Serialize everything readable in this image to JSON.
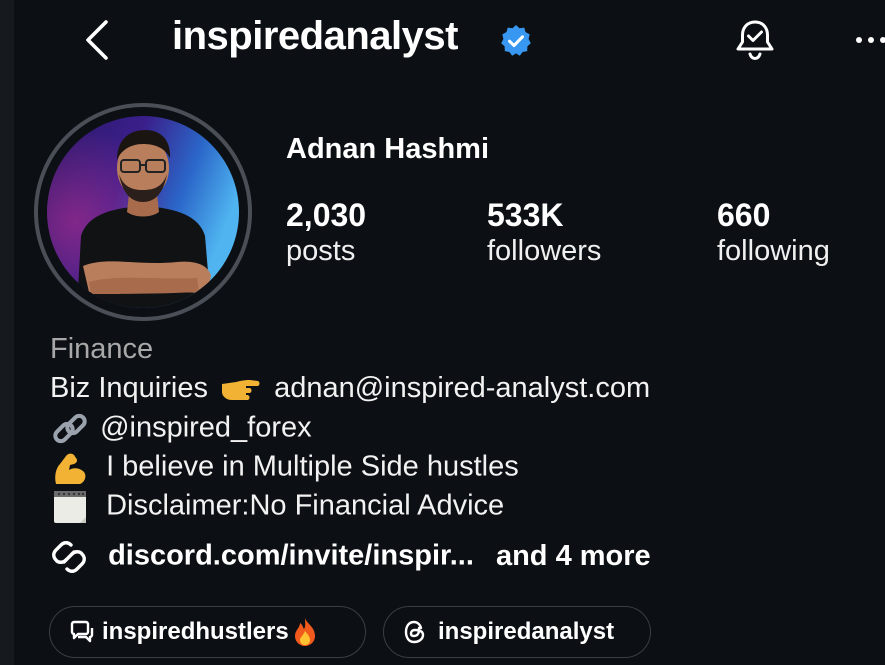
{
  "colors": {
    "background": "#0c1014",
    "verified": "#3897f0",
    "muted": "#a8a8a8",
    "accent": "#f5f5f5"
  },
  "header": {
    "username": "inspiredanalyst",
    "icons": [
      "chevron-left-icon",
      "verified-badge-icon",
      "bell-check-icon",
      "more-icon"
    ]
  },
  "profile": {
    "full_name": "Adnan Hashmi",
    "stats": [
      {
        "value": "2,030",
        "label": "posts"
      },
      {
        "value": "533K",
        "label": "followers"
      },
      {
        "value": "660",
        "label": "following"
      }
    ]
  },
  "bio": {
    "category": "Finance",
    "line1": "Biz Inquiries",
    "email": "adnan@inspired-analyst.com",
    "line2": "@inspired_forex",
    "line3": "I believe in Multiple Side hustles",
    "line4": "Disclaimer:No Financial Advice"
  },
  "links": {
    "url": "discord.com/invite/inspir...",
    "more": "and 4 more"
  },
  "pills": [
    {
      "label": "inspiredhustlers",
      "icon": "threads-chat-icon"
    },
    {
      "label": "inspiredanalyst",
      "icon": "threads-icon"
    }
  ]
}
